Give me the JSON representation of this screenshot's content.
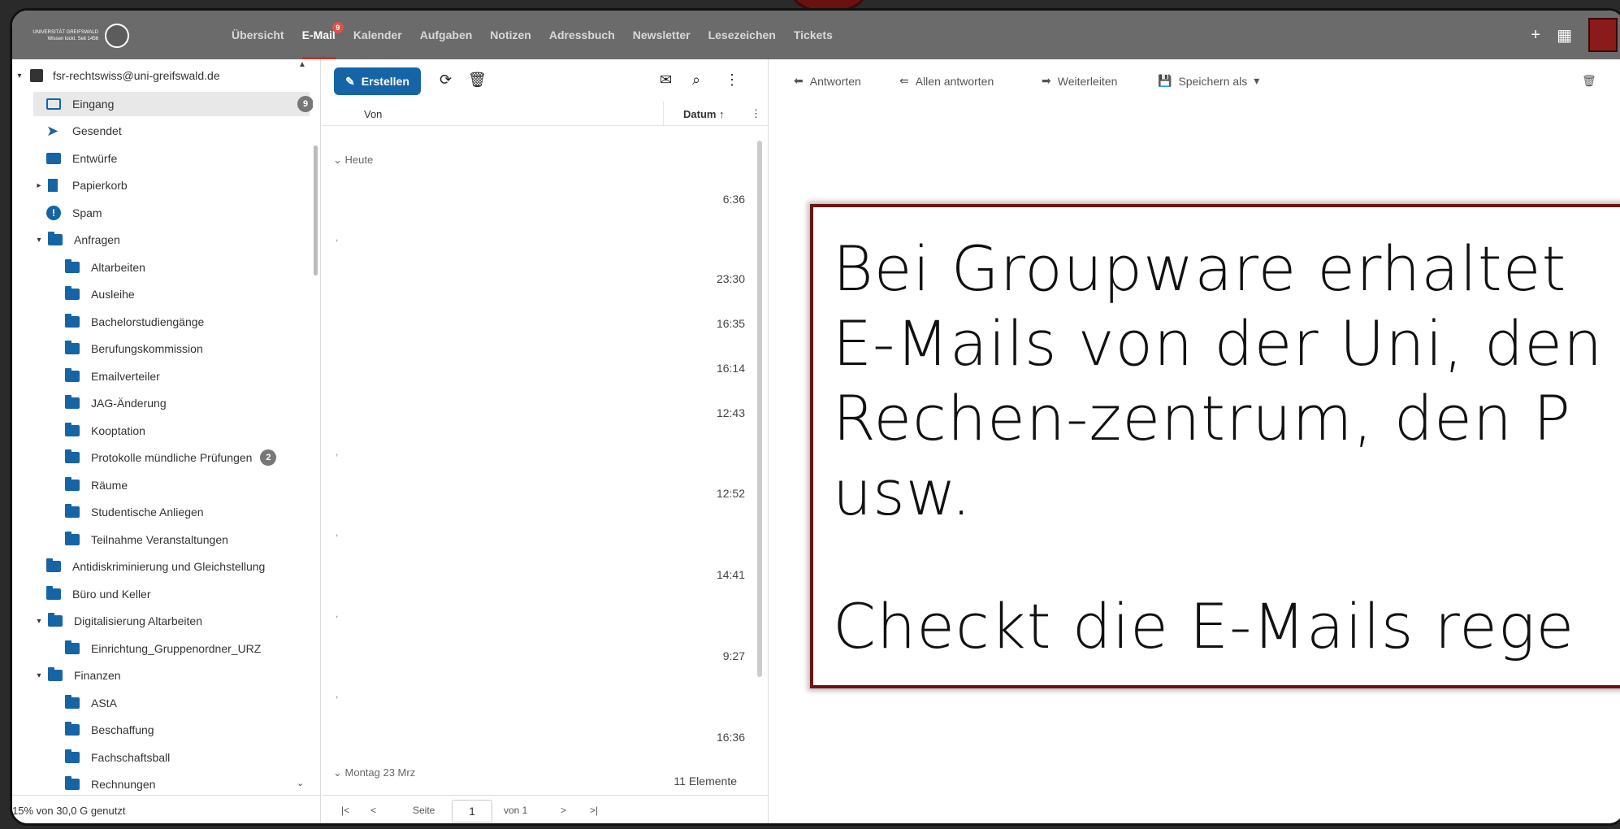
{
  "logo": {
    "text_line1": "UNIVERSITÄT GREIFSWALD",
    "text_line2": "Wissen lockt. Seit 1456"
  },
  "nav": {
    "items": [
      {
        "label": "Übersicht"
      },
      {
        "label": "E-Mail",
        "active": true,
        "badge": "9"
      },
      {
        "label": "Kalender"
      },
      {
        "label": "Aufgaben"
      },
      {
        "label": "Notizen"
      },
      {
        "label": "Adressbuch"
      },
      {
        "label": "Newsletter"
      },
      {
        "label": "Lesezeichen"
      },
      {
        "label": "Tickets"
      }
    ],
    "right": {
      "add": "+",
      "apps": "▦"
    }
  },
  "sidebar": {
    "account": "fsr-rechtswiss@uni-greifswald.de",
    "folders": [
      {
        "label": "Eingang",
        "icon": "inbox-icon",
        "badge": "9",
        "selected": true
      },
      {
        "label": "Gesendet",
        "icon": "sent-icon"
      },
      {
        "label": "Entwürfe",
        "icon": "drafts-icon"
      },
      {
        "label": "Papierkorb",
        "icon": "trash-icon",
        "caret": "▸"
      },
      {
        "label": "Spam",
        "icon": "spam-icon"
      },
      {
        "label": "Anfragen",
        "icon": "folder-icon",
        "caret": "▾"
      },
      {
        "label": "Altarbeiten",
        "icon": "folder-icon"
      },
      {
        "label": "Ausleihe",
        "icon": "folder-icon"
      },
      {
        "label": "Bachelorstudiengänge",
        "icon": "folder-icon"
      },
      {
        "label": "Berufungskommission",
        "icon": "folder-icon"
      },
      {
        "label": "Emailverteiler",
        "icon": "folder-icon"
      },
      {
        "label": "JAG-Änderung",
        "icon": "folder-icon"
      },
      {
        "label": "Kooptation",
        "icon": "folder-icon"
      },
      {
        "label": "Protokolle mündliche Prüfungen",
        "icon": "folder-icon",
        "badge": "2"
      },
      {
        "label": "Räume",
        "icon": "folder-icon"
      },
      {
        "label": "Studentische Anliegen",
        "icon": "folder-icon"
      },
      {
        "label": "Teilnahme Veranstaltungen",
        "icon": "folder-icon"
      },
      {
        "label": "Antidiskriminierung und Gleichstellung",
        "icon": "folder-icon"
      },
      {
        "label": "Büro und Keller",
        "icon": "folder-icon"
      },
      {
        "label": "Digitalisierung Altarbeiten",
        "icon": "folder-icon",
        "caret": "▾"
      },
      {
        "label": "Einrichtung_Gruppenordner_URZ",
        "icon": "folder-icon"
      },
      {
        "label": "Finanzen",
        "icon": "folder-icon",
        "caret": "▾"
      },
      {
        "label": "AStA",
        "icon": "folder-icon"
      },
      {
        "label": "Beschaffung",
        "icon": "folder-icon"
      },
      {
        "label": "Fachschaftsball",
        "icon": "folder-icon"
      },
      {
        "label": "Rechnungen",
        "icon": "folder-icon"
      }
    ],
    "quota": "15% von 30,0 G genutzt"
  },
  "list": {
    "create_label": "Erstellen",
    "col_from": "Von",
    "col_date": "Datum ↑",
    "group_today": "Heute",
    "group_monday": "Montag 23 Mrz",
    "times": [
      "6:36",
      "23:30",
      "16:35",
      "16:14",
      "12:43",
      "12:52",
      "14:41",
      "9:27",
      "16:36"
    ],
    "count": "11 Elemente",
    "pager": {
      "page_label": "Seite",
      "page_value": "1",
      "of_label": "von 1"
    }
  },
  "detail": {
    "reply": "Antworten",
    "reply_all": "Allen antworten",
    "forward": "Weiterleiten",
    "save_as": "Speichern als"
  },
  "overlay": {
    "line1": "Bei Groupware erhaltet",
    "line2": "E-Mails von der Uni, den",
    "line3": "Rechen-zentrum, den P",
    "line4": "usw.",
    "line5": "Checkt die E-Mails rege"
  }
}
